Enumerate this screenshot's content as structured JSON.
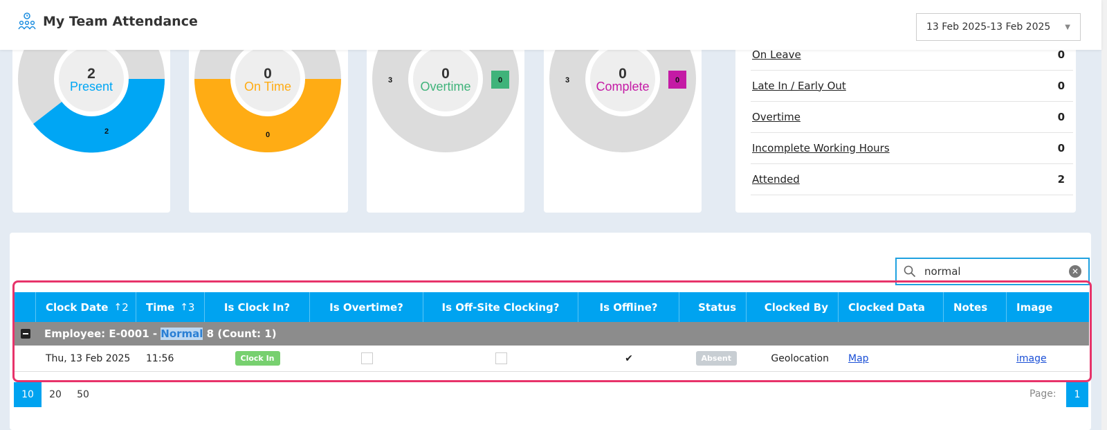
{
  "header": {
    "title": "My Team Attendance",
    "date_range": "13 Feb 2025-13 Feb 2025"
  },
  "colors": {
    "present": "#00a6f4",
    "on_time": "#ffac14",
    "overtime": "#3fb37a",
    "complete": "#c41aa5",
    "donut_bg": "#dcdcdc"
  },
  "chart_data": [
    {
      "type": "pie",
      "title": "Present",
      "center_value": "2",
      "slices": [
        {
          "label": "2",
          "value": 2,
          "color": "#00a6f4"
        }
      ]
    },
    {
      "type": "pie",
      "title": "On Time",
      "center_value": "0",
      "slices": [
        {
          "label": "0",
          "value": 0,
          "color": "#ffac14"
        }
      ]
    },
    {
      "type": "pie",
      "title": "Overtime",
      "center_value": "0",
      "slices": [
        {
          "label": "3",
          "value": 3,
          "color": "#dcdcdc"
        },
        {
          "label": "0",
          "value": 0,
          "color": "#3fb37a"
        }
      ]
    },
    {
      "type": "pie",
      "title": "Complete",
      "center_value": "0",
      "slices": [
        {
          "label": "3",
          "value": 3,
          "color": "#dcdcdc"
        },
        {
          "label": "0",
          "value": 0,
          "color": "#c41aa5"
        }
      ]
    }
  ],
  "stats": [
    {
      "label": "On Leave",
      "value": "0"
    },
    {
      "label": "Late In / Early Out",
      "value": "0"
    },
    {
      "label": "Overtime",
      "value": "0"
    },
    {
      "label": "Incomplete Working Hours",
      "value": "0"
    },
    {
      "label": "Attended",
      "value": "2"
    }
  ],
  "search": {
    "value": "normal"
  },
  "table": {
    "columns": {
      "clock_date": "Clock Date",
      "clock_date_sort": "2",
      "time": "Time",
      "time_sort": "3",
      "is_clock_in": "Is Clock In?",
      "is_overtime": "Is Overtime?",
      "is_offsite": "Is Off-Site Clocking?",
      "is_offline": "Is Offline?",
      "status": "Status",
      "clocked_by": "Clocked By",
      "clocked_data": "Clocked Data",
      "notes": "Notes",
      "image": "Image"
    },
    "group": {
      "prefix": "Employee: E-0001 - ",
      "highlight": "Normal",
      "suffix": " 8 (Count: 1)"
    },
    "row": {
      "clock_date": "Thu, 13 Feb 2025",
      "time": "11:56",
      "clock_in_badge": "Clock In",
      "status_badge": "Absent",
      "clocked_by": "Geolocation",
      "clocked_data": "Map",
      "image": "image"
    }
  },
  "pager": {
    "sizes": [
      "10",
      "20",
      "50"
    ],
    "page_label": "Page:",
    "page": "1"
  }
}
